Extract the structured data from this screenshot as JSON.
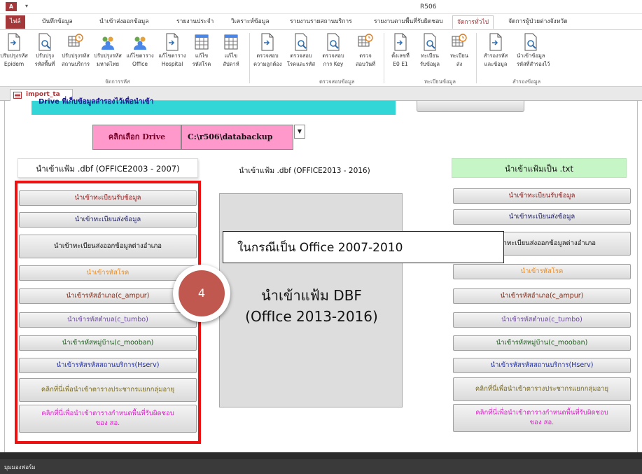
{
  "titlebar": {
    "app_icon": "A",
    "quick_access": "▾",
    "title": "R506"
  },
  "ribbon_tabs": [
    "ไฟล์",
    "บันทึกข้อมูล",
    "นำเข้าส่งออกข้อมูล",
    "รายงานประจำ",
    "วิเคราะห์ข้อมูล",
    "รายงานรายสถานบริการ",
    "รายงานตามพื้นที่รับผิดชอบ",
    "จัดการทั่วไป",
    "จัดการผู้ป่วยต่างจังหวัด"
  ],
  "ribbon_active_tab": "จัดการทั่วไป",
  "ribbon_groups": {
    "manage_codes": {
      "label": "จัดการรหัส",
      "buttons": [
        {
          "line1": "ปรับปรุงรหัส",
          "line2": "Epidem",
          "icon": "document-arrow-icon"
        },
        {
          "line1": "ปรับปรุง",
          "line2": "รหัสพื้นที่",
          "icon": "magnifier-document-icon"
        },
        {
          "line1": "ปรับปรุงรหัส",
          "line2": "สถานบริการ",
          "icon": "table-clock-icon"
        },
        {
          "line1": "ปรับปรุงรหัส",
          "line2": "มหาดไทย",
          "icon": "people-icon"
        },
        {
          "line1": "แก้ไขตาราง",
          "line2": "Office",
          "icon": "people-icon"
        },
        {
          "line1": "แก้ไขตาราง",
          "line2": "Hospital",
          "icon": "document-arrow-icon"
        },
        {
          "line1": "แก้ไข",
          "line2": "รหัสโรค",
          "icon": "table-grid-icon"
        },
        {
          "line1": "แก้ไข",
          "line2": "สัปดาห์",
          "icon": "table-grid-icon"
        }
      ]
    },
    "check_data": {
      "label": "ตรวจสอบข้อมูล",
      "buttons": [
        {
          "line1": "ตรวจสอบ",
          "line2": "ความถูกต้อง",
          "icon": "document-arrow-icon"
        },
        {
          "line1": "ตรวจสอบ",
          "line2": "โรคและรหัส",
          "icon": "magnifier-document-icon"
        },
        {
          "line1": "ตรวจสอบ",
          "line2": "การ Key",
          "icon": "magnifier-document-icon"
        },
        {
          "line1": "ตรวจ",
          "line2": "สอบวันที่",
          "icon": "table-clock-icon"
        }
      ]
    },
    "registry": {
      "label": "ทะเบียนข้อมูล",
      "buttons": [
        {
          "line1": "ตั้งเลขที่",
          "line2": "E0 E1",
          "icon": "document-arrow-icon"
        },
        {
          "line1": "ทะเบียน",
          "line2": "รับข้อมูล",
          "icon": "magnifier-document-icon"
        },
        {
          "line1": "ทะเบียน",
          "line2": "ส่ง",
          "icon": "table-clock-icon"
        }
      ]
    },
    "backup": {
      "label": "สำรองข้อมูล",
      "buttons": [
        {
          "line1": "สำรองรหัส",
          "line2": "และข้อมูล",
          "icon": "document-arrow-icon"
        },
        {
          "line1": "นำเข้าข้อมูล",
          "line2": "รหัสที่สำรองไว้",
          "icon": "magnifier-document-icon"
        }
      ]
    }
  },
  "doc_tab": {
    "label": "import_ta"
  },
  "form": {
    "cyan_banner_text": "Drive ที่เก็บข้อมูลสำรองไว้เพื่อนำเข้า",
    "drive_button_label": "คลิกเลือก Drive",
    "drive_value": "C:\\r506\\databackup",
    "header_left": "นำเข้าแฟ้ม .dbf (OFFICE2003 - 2007)",
    "header_mid": "นำเข้าแฟ้ม .dbf (OFFICE2013 - 2016)",
    "header_right": "นำเข้าแฟ้มเป็น .txt",
    "left_buttons": [
      {
        "label": "นำเข้าทะเบียนรับข้อมูล",
        "color": "dred"
      },
      {
        "label": "นำเข้าทะเบียนส่งข้อมูล",
        "color": "navy"
      },
      {
        "label": "นำเข้าทะเบียนส่งออกข้อมูลต่างอำเภอ",
        "color": "black"
      },
      {
        "label": "นำเข้ารหัสโรค",
        "color": "orange"
      },
      {
        "label": "นำเข้ารหัสอำเภอ(c_ampur)",
        "color": "brown"
      },
      {
        "label": "นำเข้ารหัสตำบล(c_tumbo)",
        "color": "purple"
      },
      {
        "label": "นำเข้ารหัสหมู่บ้าน(c_mooban)",
        "color": "green"
      },
      {
        "label": "นำเข้ารหัสรหัสสถานบริการ(Hserv)",
        "color": "blue"
      },
      {
        "label": "คลิกที่นี่เพื่อนำเข้าตารางประชากรแยกกลุ่มอายุ",
        "color": "olive"
      },
      {
        "line1": "คลิกที่นี่เพื่อนำเข้าตารางกำหนดพื้นที่รับผิดชอบ",
        "line2": "ของ สอ.",
        "color": "magenta"
      }
    ],
    "right_buttons": [
      {
        "label": "นำเข้าทะเบียนรับข้อมูล",
        "color": "dred"
      },
      {
        "label": "นำเข้าทะเบียนส่งข้อมูล",
        "color": "navy"
      },
      {
        "label": "นำเข้าทะเบียนส่งออกข้อมูลต่างอำเภอ",
        "color": "black"
      },
      {
        "label": "นำเข้ารหัสโรค",
        "color": "orange"
      },
      {
        "label": "นำเข้ารหัสอำเภอ(c_ampur)",
        "color": "brown"
      },
      {
        "label": "นำเข้ารหัสตำบล(c_tumbo)",
        "color": "purple"
      },
      {
        "label": "นำเข้ารหัสหมู่บ้าน(c_mooban)",
        "color": "green"
      },
      {
        "label": "นำเข้ารหัสรหัสสถานบริการ(Hserv)",
        "color": "blue"
      },
      {
        "label": "คลิกที่นี่เพื่อนำเข้าตารางประชากรแยกกลุ่มอายุ",
        "color": "olive"
      },
      {
        "line1": "คลิกที่นี่เพื่อนำเข้าตารางกำหนดพื้นที่รับผิดชอบ",
        "line2": "ของ สอ.",
        "color": "magenta"
      }
    ],
    "big_button_line1": "นำเข้าแฟ้ม DBF",
    "big_button_line2": "(OffIce 2013-2016)",
    "callout_text": "ในกรณีเป็น Office 2007-2010",
    "step_badge": "4"
  },
  "status_bar": {
    "text": "มุมมองฟอร์ม"
  },
  "colors": {
    "accent": "#a4373a",
    "red_frame": "#ee1111",
    "cyan_banner": "#33d6d6",
    "pink_drive": "#ff99cc",
    "green_header": "#c6f5c6",
    "badge": "#c0584f"
  }
}
